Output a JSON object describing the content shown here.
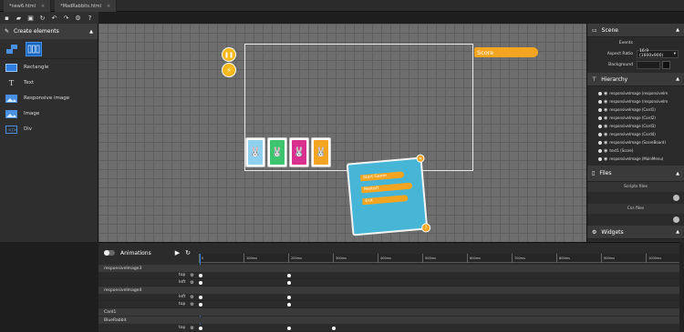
{
  "tabs": [
    {
      "label": "*new6.html",
      "close": "×"
    },
    {
      "label": "*MadRabbits.html",
      "close": "×"
    }
  ],
  "toolbar_icons": [
    "new-file-icon",
    "open-folder-icon",
    "save-icon",
    "refresh-icon",
    "undo-icon",
    "redo-icon",
    "settings-icon",
    "help-icon"
  ],
  "left_panel": {
    "header": "Create elements",
    "items": [
      {
        "label": "Rectangle",
        "icon": "rectangle-icon"
      },
      {
        "label": "Text",
        "icon": "text-icon"
      },
      {
        "label": "Responsive image",
        "icon": "responsive-image-icon"
      },
      {
        "label": "Image",
        "icon": "image-icon"
      },
      {
        "label": "Div",
        "icon": "div-icon"
      }
    ]
  },
  "canvas": {
    "score_label": "Score",
    "pause_icon": "❚❚",
    "bolt_icon": "⚡",
    "cards": [
      {
        "color": "#8fd0ef",
        "emoji": "🐰"
      },
      {
        "color": "#3cc56e",
        "emoji": "🐰"
      },
      {
        "color": "#d9308f",
        "emoji": "🐰"
      },
      {
        "color": "#f3a521",
        "emoji": "🐰"
      }
    ],
    "menu_items": [
      "Start Game",
      "Restart",
      "Exit"
    ]
  },
  "right_panel": {
    "scene_title": "Scene",
    "events_label": "Events",
    "aspect_label": "Aspect Ratio",
    "aspect_value": "16:9 (1600x900)",
    "background_label": "Background",
    "hierarchy_title": "Hierarchy",
    "hierarchy_items": [
      "responsiveImage (responsiveIm",
      "responsiveImage (responsiveIm",
      "responsiveImage (Card1)",
      "responsiveImage (Card2)",
      "responsiveImage (Card3)",
      "responsiveImage (Card4)",
      "responsiveImage (ScoreBoard)",
      "text1 (Score)",
      "responsiveImage (MainMenu)"
    ],
    "files_title": "Files",
    "scripts_label": "Scripts files",
    "css_label": "Css files",
    "widgets_title": "Widgets"
  },
  "animations": {
    "title": "Animations",
    "ruler_ticks": [
      "0",
      "100ms",
      "200ms",
      "300ms",
      "400ms",
      "500ms",
      "600ms",
      "700ms",
      "800ms",
      "900ms",
      "1000ms"
    ],
    "rows": [
      {
        "type": "group",
        "label": "responsiveImage3"
      },
      {
        "type": "prop",
        "label": "top"
      },
      {
        "type": "prop",
        "label": "left"
      },
      {
        "type": "group",
        "label": "responsiveImage4"
      },
      {
        "type": "prop",
        "label": "left"
      },
      {
        "type": "prop",
        "label": "top"
      },
      {
        "type": "group",
        "label": "Card1"
      },
      {
        "type": "group",
        "label": "BlueRabbit"
      },
      {
        "type": "prop",
        "label": "top"
      }
    ]
  },
  "colors": {
    "accent_blue": "#1565c0",
    "panel_bg": "#2e2e2e",
    "canvas_bg": "#6e6e6e",
    "orange": "#f3a521"
  }
}
